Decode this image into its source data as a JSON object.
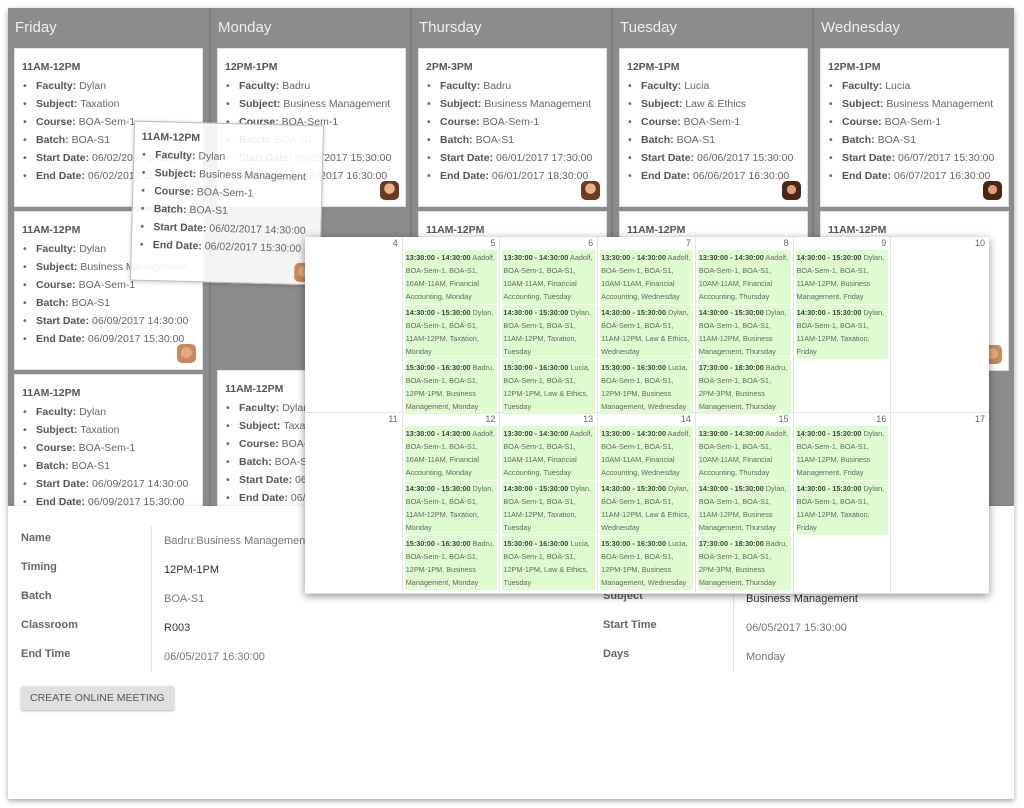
{
  "board": {
    "columns": [
      {
        "day": "Friday",
        "cards": [
          {
            "time": "11AM-12PM",
            "faculty": "Dylan",
            "subject": "Taxation",
            "course": "BOA-Sem-1",
            "batch": "BOA-S1",
            "start": "06/02/2017 14:30:00",
            "end": "06/02/2017 15:30:00"
          },
          {
            "time": "11AM-12PM",
            "faculty": "Dylan",
            "subject": "Business Management",
            "course": "BOA-Sem-1",
            "batch": "BOA-S1",
            "start": "06/09/2017 14:30:00",
            "end": "06/09/2017 15:30:00"
          },
          {
            "time": "11AM-12PM",
            "faculty": "Dylan",
            "subject": "Taxation",
            "course": "BOA-Sem-1",
            "batch": "BOA-S1",
            "start": "06/09/2017 14:30:00",
            "end": "06/09/2017 15:30:00"
          }
        ]
      },
      {
        "day": "Monday",
        "cards": [
          {
            "time": "12PM-1PM",
            "faculty": "Badru",
            "subject": "Business Management",
            "course": "BOA-Sem-1",
            "batch": "BOA-S1",
            "start": "06/05/2017 15:30:00",
            "end": "06/05/2017 16:30:00"
          },
          {
            "time": "11AM-12PM",
            "faculty": "Dylan",
            "subject": "Taxation",
            "course": "BOA-Sem-1",
            "batch": "BOA-S1",
            "start": "06/0",
            "end": "06/0"
          }
        ]
      },
      {
        "day": "Thursday",
        "cards": [
          {
            "time": "2PM-3PM",
            "faculty": "Badru",
            "subject": "Business Management",
            "course": "BOA-Sem-1",
            "batch": "BOA-S1",
            "start": "06/01/2017 17:30:00",
            "end": "06/01/2017 18:30:00"
          },
          {
            "time": "11AM-12PM"
          }
        ]
      },
      {
        "day": "Tuesday",
        "cards": [
          {
            "time": "12PM-1PM",
            "faculty": "Lucia",
            "subject": "Law & Ethics",
            "course": "BOA-Sem-1",
            "batch": "BOA-S1",
            "start": "06/06/2017 15:30:00",
            "end": "06/06/2017 16:30:00"
          },
          {
            "time": "11AM-12PM"
          }
        ]
      },
      {
        "day": "Wednesday",
        "cards": [
          {
            "time": "12PM-1PM",
            "faculty": "Lucia",
            "subject": "Business Management",
            "course": "BOA-Sem-1",
            "batch": "BOA-S1",
            "start": "06/07/2017 15:30:00",
            "end": "06/07/2017 16:30:00"
          },
          {
            "time": "11AM-12PM"
          }
        ]
      }
    ],
    "labels": {
      "faculty": "Faculty:",
      "subject": "Subject:",
      "course": "Course:",
      "batch": "Batch:",
      "start": "Start Date:",
      "end": "End Date:"
    },
    "dragged_card": {
      "time": "11AM-12PM",
      "faculty": "Dylan",
      "subject": "Business Management",
      "course": "BOA-Sem-1",
      "batch": "BOA-S1",
      "start": "06/02/2017 14:30:00",
      "end": "06/02/2017 15:30:00"
    }
  },
  "calendar": {
    "weeks": [
      [
        {
          "day": "4",
          "events": []
        },
        {
          "day": "5",
          "events": [
            {
              "time": "13:30:00 - 14:30:00",
              "text": "Aadolf, BOA-Sem-1, BOA-S1, 10AM-11AM, Financial Accounting, Monday"
            },
            {
              "time": "14:30:00 - 15:30:00",
              "text": "Dylan, BOA-Sem-1, BOA-S1, 11AM-12PM, Taxation, Monday"
            },
            {
              "time": "15:30:00 - 16:30:00",
              "text": "Badru, BOA-Sem-1, BOA-S1, 12PM-1PM, Business Management, Monday"
            }
          ]
        },
        {
          "day": "6",
          "events": [
            {
              "time": "13:30:00 - 14:30:00",
              "text": "Aadolf, BOA-Sem-1, BOA-S1, 10AM-11AM, Financial Accounting, Tuesday"
            },
            {
              "time": "14:30:00 - 15:30:00",
              "text": "Dylan, BOA-Sem-1, BOA-S1, 11AM-12PM, Taxation, Tuesday"
            },
            {
              "time": "15:30:00 - 16:30:00",
              "text": "Lucia, BOA-Sem-1, BOA-S1, 12PM-1PM, Law & Ethics, Tuesday"
            }
          ]
        },
        {
          "day": "7",
          "events": [
            {
              "time": "13:30:00 - 14:30:00",
              "text": "Aadolf, BOA-Sem-1, BOA-S1, 10AM-11AM, Financial Accounting, Wednesday"
            },
            {
              "time": "14:30:00 - 15:30:00",
              "text": "Dylan, BOA-Sem-1, BOA-S1, 11AM-12PM, Law & Ethics, Wednesday"
            },
            {
              "time": "15:30:00 - 16:30:00",
              "text": "Lucia, BOA-Sem-1, BOA-S1, 12PM-1PM, Business Management, Wednesday"
            }
          ]
        },
        {
          "day": "8",
          "events": [
            {
              "time": "13:30:00 - 14:30:00",
              "text": "Aadolf, BOA-Sem-1, BOA-S1, 10AM-11AM, Financial Accounting, Thursday"
            },
            {
              "time": "14:30:00 - 15:30:00",
              "text": "Dylan, BOA-Sem-1, BOA-S1, 11AM-12PM, Business Management, Thursday"
            },
            {
              "time": "17:30:00 - 18:30:00",
              "text": "Badru, BOA-Sem-1, BOA-S1, 2PM-3PM, Business Management, Thursday"
            }
          ]
        },
        {
          "day": "9",
          "events": [
            {
              "time": "14:30:00 - 15:30:00",
              "text": "Dylan, BOA-Sem-1, BOA-S1, 11AM-12PM, Business Management, Friday"
            },
            {
              "time": "14:30:00 - 15:30:00",
              "text": "Dylan, BOA-Sem-1, BOA-S1, 11AM-12PM, Taxation, Friday"
            }
          ]
        },
        {
          "day": "10",
          "events": []
        }
      ],
      [
        {
          "day": "11",
          "events": []
        },
        {
          "day": "12",
          "events": [
            {
              "time": "13:30:00 - 14:30:00",
              "text": "Aadolf, BOA-Sem-1, BOA-S1, 10AM-11AM, Financial Accounting, Monday"
            },
            {
              "time": "14:30:00 - 15:30:00",
              "text": "Dylan, BOA-Sem-1, BOA-S1, 11AM-12PM, Taxation, Monday"
            },
            {
              "time": "15:30:00 - 16:30:00",
              "text": "Badru, BOA-Sem-1, BOA-S1, 12PM-1PM, Business Management, Monday"
            }
          ]
        },
        {
          "day": "13",
          "events": [
            {
              "time": "13:30:00 - 14:30:00",
              "text": "Aadolf, BOA-Sem-1, BOA-S1, 10AM-11AM, Financial Accounting, Tuesday"
            },
            {
              "time": "14:30:00 - 15:30:00",
              "text": "Dylan, BOA-Sem-1, BOA-S1, 11AM-12PM, Taxation, Tuesday"
            },
            {
              "time": "15:30:00 - 16:30:00",
              "text": "Lucia, BOA-Sem-1, BOA-S1, 12PM-1PM, Law & Ethics, Tuesday"
            }
          ]
        },
        {
          "day": "14",
          "events": [
            {
              "time": "13:30:00 - 14:30:00",
              "text": "Aadolf, BOA-Sem-1, BOA-S1, 10AM-11AM, Financial Accounting, Wednesday"
            },
            {
              "time": "14:30:00 - 15:30:00",
              "text": "Dylan, BOA-Sem-1, BOA-S1, 11AM-12PM, Law & Ethics, Wednesday"
            },
            {
              "time": "15:30:00 - 16:30:00",
              "text": "Lucia, BOA-Sem-1, BOA-S1, 12PM-1PM, Business Management, Wednesday"
            }
          ]
        },
        {
          "day": "15",
          "events": [
            {
              "time": "13:30:00 - 14:30:00",
              "text": "Aadolf, BOA-Sem-1, BOA-S1, 10AM-11AM, Financial Accounting, Thursday"
            },
            {
              "time": "14:30:00 - 15:30:00",
              "text": "Dylan, BOA-Sem-1, BOA-S1, 11AM-12PM, Business Management, Thursday"
            },
            {
              "time": "17:30:00 - 18:30:00",
              "text": "Badru, BOA-Sem-1, BOA-S1, 2PM-3PM, Business Management, Thursday"
            }
          ]
        },
        {
          "day": "16",
          "events": [
            {
              "time": "14:30:00 - 15:30:00",
              "text": "Dylan, BOA-Sem-1, BOA-S1, 11AM-12PM, Business Management, Friday"
            },
            {
              "time": "14:30:00 - 15:30:00",
              "text": "Dylan, BOA-Sem-1, BOA-S1, 11AM-12PM, Taxation, Friday"
            }
          ]
        },
        {
          "day": "17",
          "events": []
        }
      ]
    ]
  },
  "details": {
    "left": [
      {
        "label": "Name",
        "value": "Badru:Business Management"
      },
      {
        "label": "Timing",
        "value": "12PM-1PM"
      },
      {
        "label": "Batch",
        "value": "BOA-S1"
      },
      {
        "label": "Classroom",
        "value": "R003"
      },
      {
        "label": "End Time",
        "value": "06/05/2017 16:30:00"
      }
    ],
    "right": [
      {
        "label": "Subject",
        "value": "Business Management"
      },
      {
        "label": "Start Time",
        "value": "06/05/2017 15:30:00"
      },
      {
        "label": "Days",
        "value": "Monday"
      }
    ],
    "button_label": "CREATE ONLINE MEETING"
  }
}
